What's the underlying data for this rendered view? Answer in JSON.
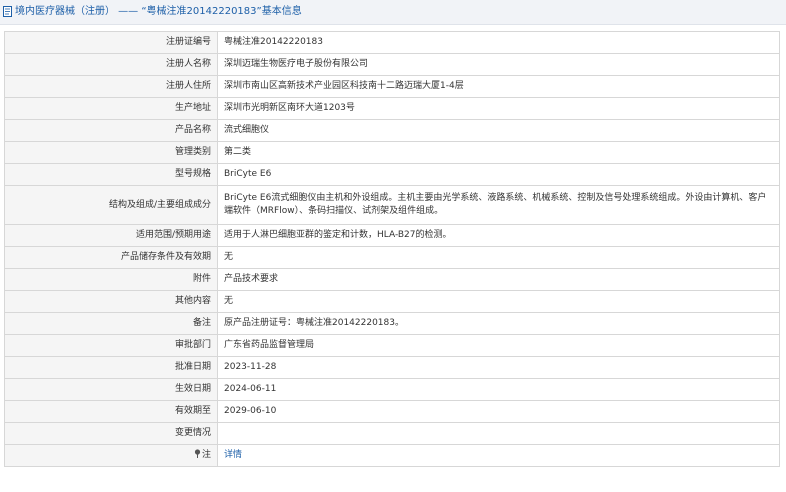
{
  "header": {
    "title": "境内医疗器械（注册） —— “粤械注准20142220183”基本信息"
  },
  "rows": [
    {
      "label": "注册证编号",
      "value": "粤械注准20142220183"
    },
    {
      "label": "注册人名称",
      "value": "深圳迈瑞生物医疗电子股份有限公司"
    },
    {
      "label": "注册人住所",
      "value": "深圳市南山区高新技术产业园区科技南十二路迈瑞大厦1-4层"
    },
    {
      "label": "生产地址",
      "value": "深圳市光明新区南环大道1203号"
    },
    {
      "label": "产品名称",
      "value": "流式细胞仪"
    },
    {
      "label": "管理类别",
      "value": "第二类"
    },
    {
      "label": "型号规格",
      "value": "BriCyte E6"
    },
    {
      "label": "结构及组成/主要组成成分",
      "value": "BriCyte E6流式细胞仪由主机和外设组成。主机主要由光学系统、液路系统、机械系统、控制及信号处理系统组成。外设由计算机、客户端软件（MRFlow）、条码扫描仪、试剂架及组件组成。"
    },
    {
      "label": "适用范围/预期用途",
      "value": "适用于人淋巴细胞亚群的鉴定和计数，HLA-B27的检测。"
    },
    {
      "label": "产品储存条件及有效期",
      "value": "无"
    },
    {
      "label": "附件",
      "value": "产品技术要求"
    },
    {
      "label": "其他内容",
      "value": "无"
    },
    {
      "label": "备注",
      "value": "原产品注册证号：粤械注准20142220183。"
    },
    {
      "label": "审批部门",
      "value": "广东省药品监督管理局"
    },
    {
      "label": "批准日期",
      "value": "2023-11-28"
    },
    {
      "label": "生效日期",
      "value": "2024-06-11"
    },
    {
      "label": "有效期至",
      "value": "2029-06-10"
    },
    {
      "label": "变更情况",
      "value": ""
    }
  ],
  "note_row": {
    "label": "注",
    "link_text": "详情",
    "icon": "pin-icon"
  },
  "colors": {
    "accent": "#1d5fa8",
    "label_bg": "#f5f5f5",
    "border": "#d7d7d7",
    "header_bg": "#f1f3f7"
  }
}
